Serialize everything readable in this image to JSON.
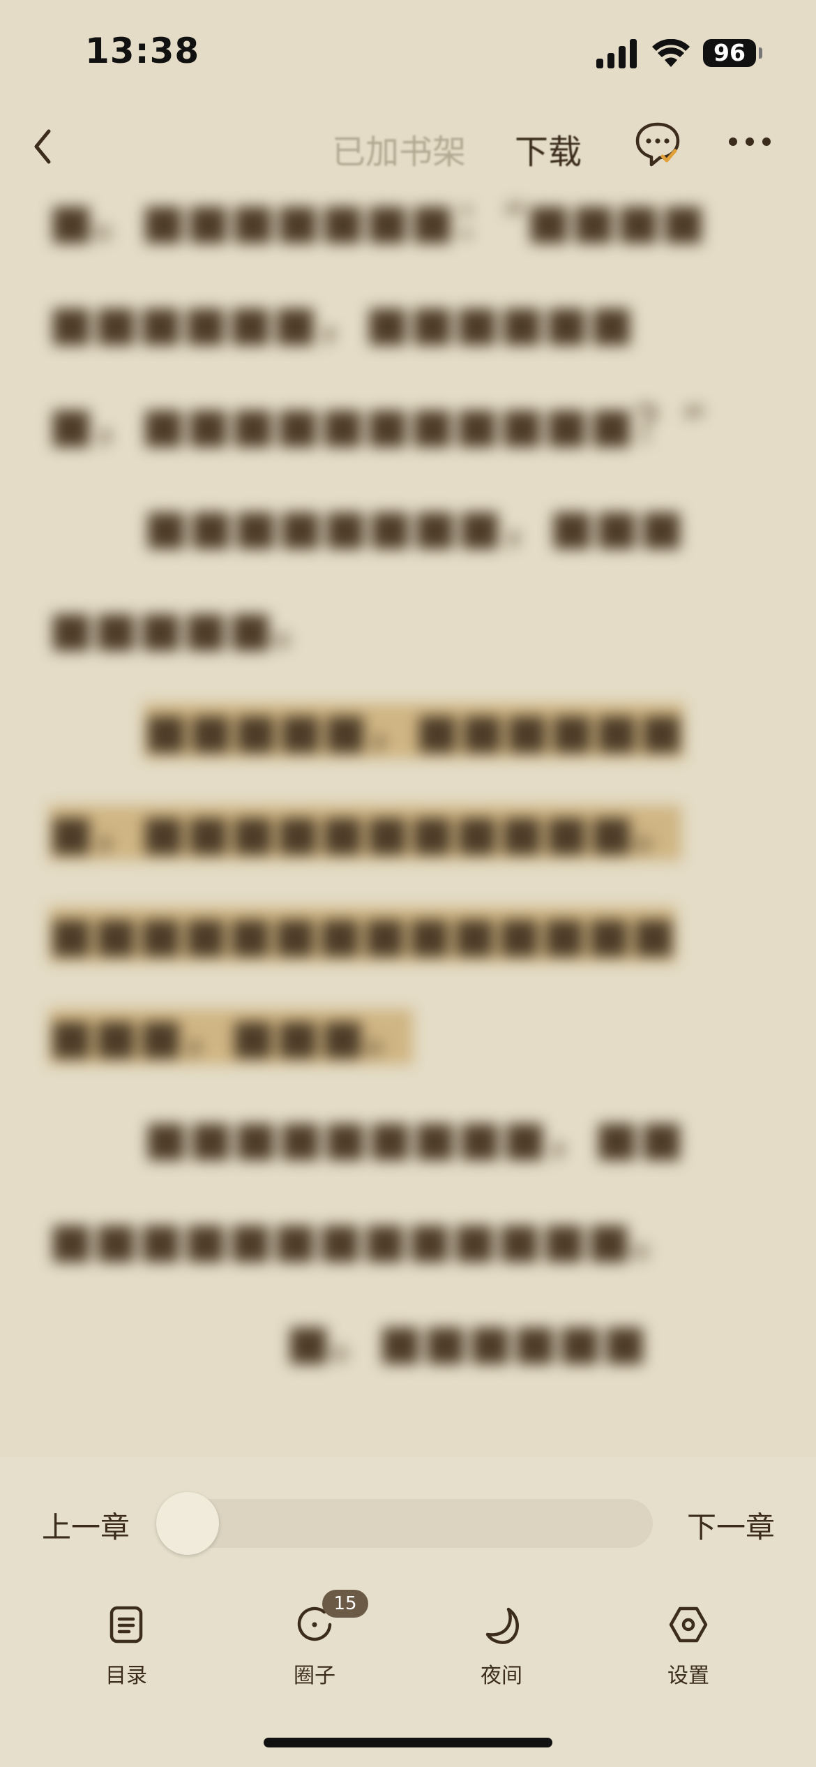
{
  "status_bar": {
    "time": "13:38",
    "battery": "96"
  },
  "nav": {
    "back_icon": "chevron-left-icon",
    "shelf_status": "已加书架",
    "download_label": "下载",
    "comment_icon": "comment-check-icon",
    "more_icon": "more-dots-icon"
  },
  "reader": {
    "progress": 0.0,
    "prev_chapter": "上一章",
    "next_chapter": "下一章"
  },
  "tabs": [
    {
      "label": "目录",
      "icon": "toc-icon"
    },
    {
      "label": "圈子",
      "icon": "circle-icon",
      "badge": "15"
    },
    {
      "label": "夜间",
      "icon": "moon-icon"
    },
    {
      "label": "设置",
      "icon": "settings-hexagon-icon"
    }
  ],
  "colors": {
    "background": "#e4dcc6",
    "highlight": "#cfb583",
    "accent": "#e0a03a",
    "text": "#3b2c1b"
  }
}
